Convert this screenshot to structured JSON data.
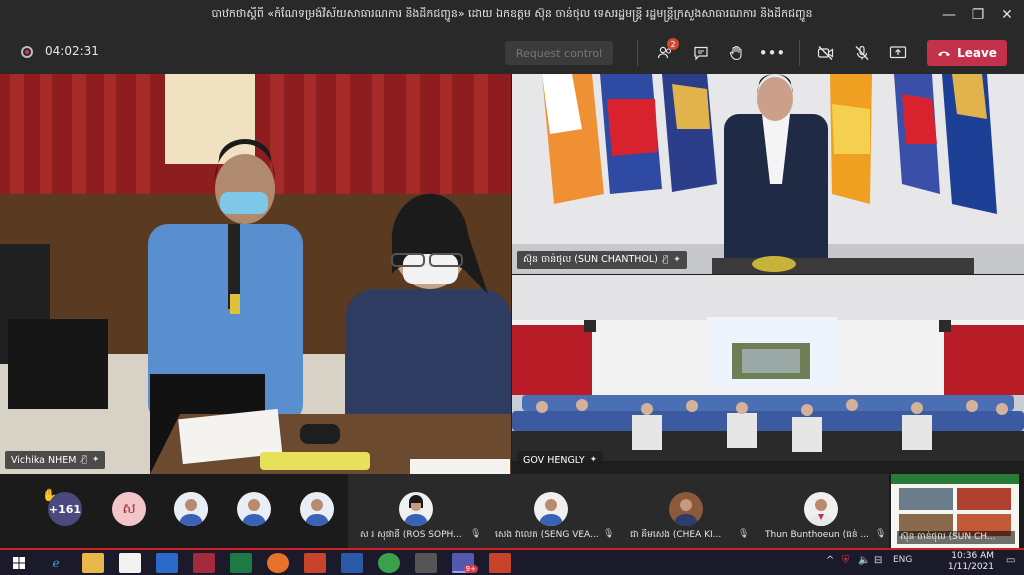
{
  "window": {
    "title": "បាឋកថាស្តីពី «កំណែទម្រង់វិស័យសាធារណការ និងដឹកជញ្ជូន» ដោយ ឯកឧត្តម ស៊ុន ចាន់ថុល ទេសរដ្ឋមន្ត្រី រដ្ឋមន្ត្រីក្រសួងសាធារណការ និងដឹកជញ្ជូន",
    "minimize": "—",
    "restore": "❐",
    "close": "✕"
  },
  "toolbar": {
    "timer": "04:02:31",
    "request_control_label": "Request control",
    "participants_badge": "2",
    "leave_label": "Leave",
    "icons": [
      "participants-icon",
      "chat-icon",
      "raise-hand-icon",
      "more-icon",
      "camera-off-icon",
      "mic-off-icon",
      "share-screen-icon",
      "phone-icon"
    ]
  },
  "tiles": {
    "left_name": "Vichika NHEM",
    "top_right_name": "ស៊ុន ចាន់ថុល (SUN CHANTHOL)",
    "bottom_right_name": "GOV HENGLY"
  },
  "participants": {
    "overflow_count": "+161",
    "khmer_initial": "ស",
    "named": [
      {
        "label": "ស រ សុផានី (ROS SOPH..."
      },
      {
        "label": "សេង វាលេត (SENG VEA..."
      },
      {
        "label": "ជា គឹមសេង (CHEA KI..."
      },
      {
        "label": "Thun Bunthoeun (ធន់ ..."
      },
      {
        "label": "ស៊ុន ចាន់ថុល (SUN CH..."
      }
    ]
  },
  "taskbar": {
    "time": "10:36 AM",
    "date": "1/11/2021",
    "lang": "ENG",
    "teams_badge": "9+"
  },
  "colors": {
    "leave": "#c4314b",
    "teams_bg": "#292929",
    "taskbar_accent": "#d41f27"
  }
}
